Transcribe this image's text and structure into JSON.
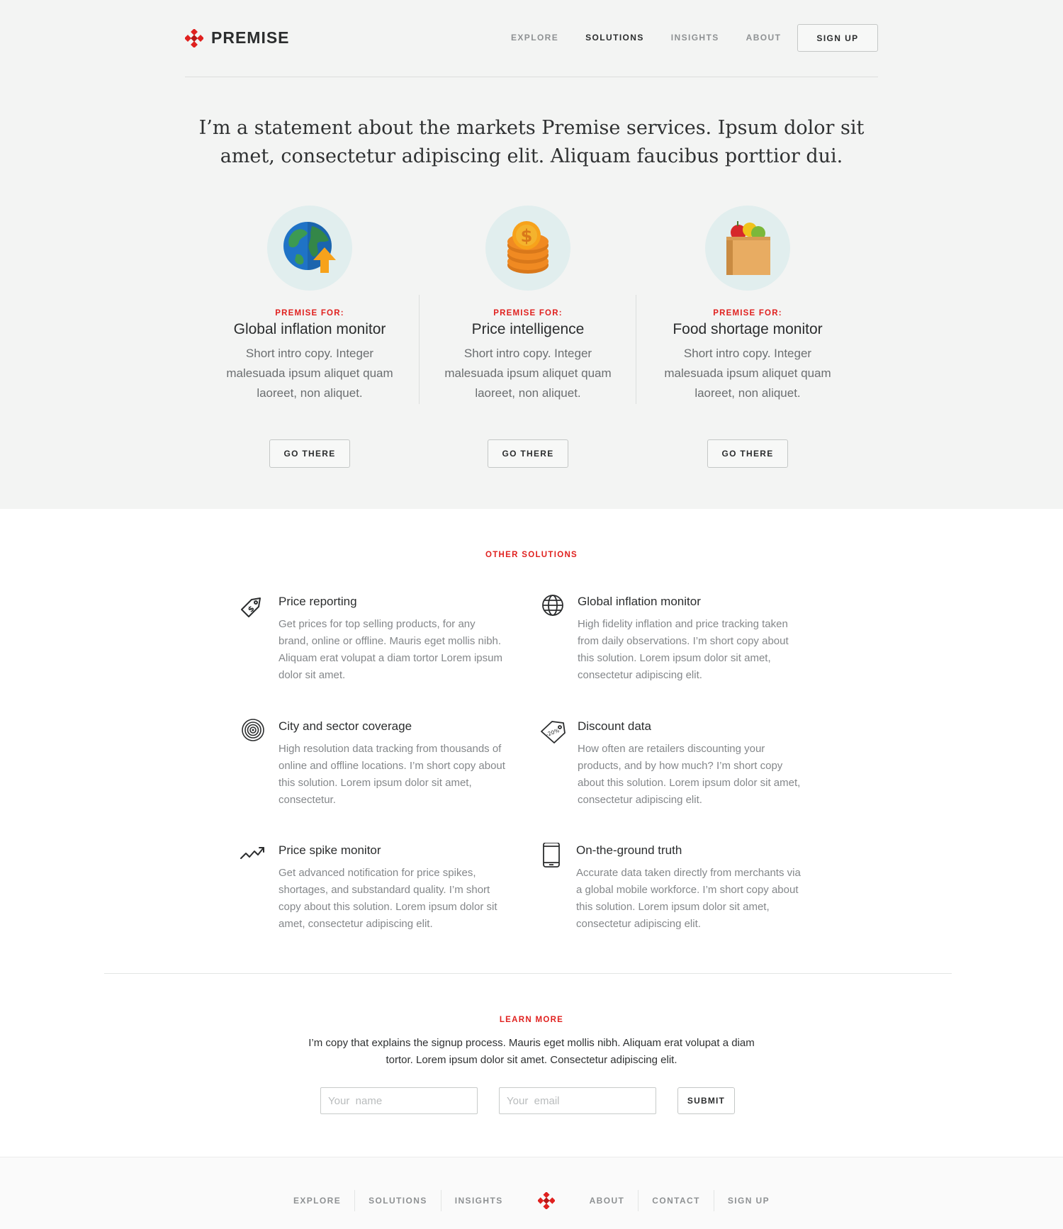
{
  "brand": {
    "name": "PREMISE",
    "accent_color": "#e0211f"
  },
  "nav": {
    "items": [
      {
        "label": "EXPLORE"
      },
      {
        "label": "SOLUTIONS"
      },
      {
        "label": "INSIGHTS"
      },
      {
        "label": "ABOUT"
      }
    ],
    "active": "SOLUTIONS",
    "signup_label": "SIGN UP"
  },
  "hero": {
    "statement": "I’m a statement about the markets Premise services. Ipsum dolor sit amet, consectetur adipiscing elit. Aliquam faucibus porttior dui.",
    "features": [
      {
        "icon": "globe-upload-icon",
        "eyebrow": "PREMISE FOR:",
        "title": "Global inflation monitor",
        "desc": "Short intro copy. Integer malesuada ipsum aliquet quam laoreet, non aliquet.",
        "button": "GO THERE"
      },
      {
        "icon": "coins-icon",
        "eyebrow": "PREMISE FOR:",
        "title": "Price intelligence",
        "desc": "Short intro copy. Integer malesuada ipsum aliquet quam laoreet, non aliquet.",
        "button": "GO THERE"
      },
      {
        "icon": "grocery-bag-icon",
        "eyebrow": "PREMISE FOR:",
        "title": "Food shortage monitor",
        "desc": "Short intro copy. Integer malesuada ipsum aliquet quam laoreet, non aliquet.",
        "button": "GO THERE"
      }
    ]
  },
  "other_solutions": {
    "label": "OTHER SOLUTIONS",
    "items": [
      {
        "icon": "price-tag-icon",
        "title": "Price reporting",
        "desc": "Get prices for top selling products, for any brand, online or offline. Mauris eget mollis nibh. Aliquam erat volupat a diam tortor Lorem ipsum dolor sit amet."
      },
      {
        "icon": "globe-icon",
        "title": "Global inflation monitor",
        "desc": "High fidelity inflation and price tracking taken from daily observations. I’m short copy about this solution. Lorem ipsum dolor sit amet, consectetur adipiscing elit."
      },
      {
        "icon": "target-icon",
        "title": "City and sector coverage",
        "desc": "High resolution data tracking from thousands of online and offline locations. I’m short copy about this solution. Lorem ipsum dolor sit amet, consectetur."
      },
      {
        "icon": "discount-tag-icon",
        "icon_text": "-20%",
        "title": "Discount data",
        "desc": "How often are retailers discounting your products, and by how much? I’m short copy about this solution. Lorem ipsum dolor sit amet, consectetur adipiscing elit."
      },
      {
        "icon": "trend-up-icon",
        "title": "Price spike monitor",
        "desc": "Get advanced notification for price spikes, shortages, and substandard quality. I’m short copy about this solution. Lorem ipsum dolor sit amet, consectetur adipiscing elit."
      },
      {
        "icon": "mobile-phone-icon",
        "title": "On-the-ground truth",
        "desc": "Accurate data taken directly from merchants via a global mobile workforce. I’m short copy about this solution. Lorem ipsum dolor sit amet, consectetur adipiscing elit."
      }
    ]
  },
  "learn_more": {
    "label": "LEARN MORE",
    "copy": "I’m copy that explains the signup process. Mauris eget mollis nibh. Aliquam erat volupat a diam tortor. Lorem ipsum dolor sit amet. Consectetur adipiscing elit.",
    "name_placeholder": "Your  name",
    "email_placeholder": "Your  email",
    "name_value": "",
    "email_value": "",
    "submit_label": "SUBMIT"
  },
  "footer": {
    "links_left": [
      {
        "label": "EXPLORE"
      },
      {
        "label": "SOLUTIONS"
      },
      {
        "label": "INSIGHTS"
      }
    ],
    "links_right": [
      {
        "label": "ABOUT"
      },
      {
        "label": "CONTACT"
      },
      {
        "label": "SIGN UP"
      }
    ]
  }
}
